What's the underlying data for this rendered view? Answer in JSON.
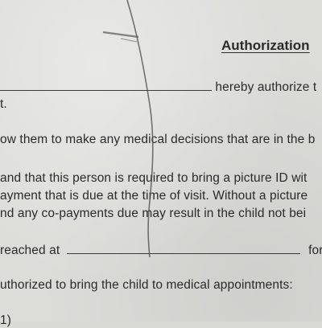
{
  "document": {
    "title": "Authorization",
    "lines": [
      "hereby authorize t",
      "t.",
      "ow them to make any medical decisions that are in the b",
      "and that this person is required to bring a picture ID wit",
      "ayment that is due at the time of visit.  Without a picture",
      "nd any co-payments due may result in the child not bei",
      "reached at",
      "for",
      "uthorized to bring the child to medical appointments:",
      "1)"
    ]
  }
}
